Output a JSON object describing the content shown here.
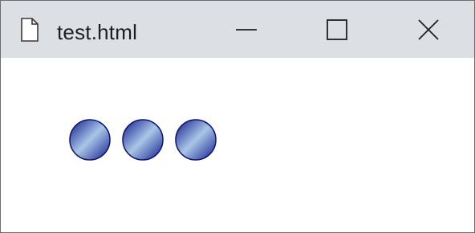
{
  "window": {
    "title": "test.html",
    "file_icon": "document-icon",
    "controls": {
      "minimize_icon": "minimize-icon",
      "maximize_icon": "maximize-icon",
      "close_icon": "close-icon"
    }
  },
  "content": {
    "balls": [
      {
        "color_dark": "#101a8c",
        "color_light": "#a9c6e6"
      },
      {
        "color_dark": "#101a8c",
        "color_light": "#a9c6e6"
      },
      {
        "color_dark": "#101a8c",
        "color_light": "#a9c6e6"
      }
    ]
  },
  "colors": {
    "titlebar_bg": "#dcdfe4",
    "window_border": "#6d6d6d",
    "client_bg": "#ffffff"
  }
}
